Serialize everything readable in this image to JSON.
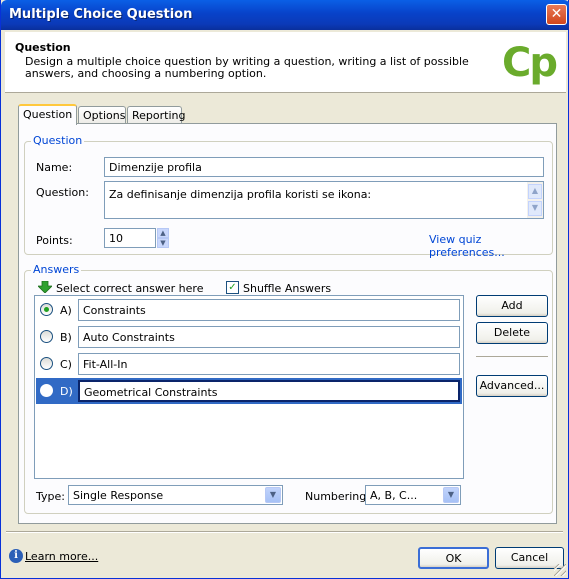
{
  "window": {
    "title": "Multiple Choice Question",
    "close_glyph": "✕"
  },
  "header": {
    "title": "Question",
    "description": "Design a multiple choice question by writing a question, writing a list of possible answers, and choosing a numbering option.",
    "logo": "Cp",
    "logo_color": "#6aab2c"
  },
  "tabs": [
    {
      "label": "Question",
      "active": true
    },
    {
      "label": "Options",
      "active": false
    },
    {
      "label": "Reporting",
      "active": false
    }
  ],
  "question_group": {
    "legend": "Question",
    "name_label": "Name:",
    "name_value": "Dimenzije profila",
    "question_label": "Question:",
    "question_value": "Za definisanje dimenzija profila koristi se ikona:",
    "points_label": "Points:",
    "points_value": "10",
    "quiz_prefs_link": "View quiz preferences..."
  },
  "answers_group": {
    "legend": "Answers",
    "select_hint": "Select correct answer here",
    "shuffle_label": "Shuffle Answers",
    "shuffle_checked": true,
    "items": [
      {
        "letter": "A)",
        "text": "Constraints",
        "correct": true,
        "selected": false
      },
      {
        "letter": "B)",
        "text": "Auto Constraints",
        "correct": false,
        "selected": false
      },
      {
        "letter": "C)",
        "text": "Fit-All-In",
        "correct": false,
        "selected": false
      },
      {
        "letter": "D)",
        "text": "Geometrical Constraints",
        "correct": false,
        "selected": true
      }
    ],
    "add_label": "Add",
    "delete_label": "Delete",
    "advanced_label": "Advanced...",
    "type_label": "Type:",
    "type_value": "Single Response",
    "numbering_label": "Numbering:",
    "numbering_value": "A, B, C..."
  },
  "footer": {
    "learn_more": "Learn more...",
    "ok_label": "OK",
    "cancel_label": "Cancel"
  },
  "colors": {
    "titlebar": "#0842c9",
    "link": "#0046d5",
    "selection": "#316ac5",
    "window_bg": "#ece9d8"
  }
}
